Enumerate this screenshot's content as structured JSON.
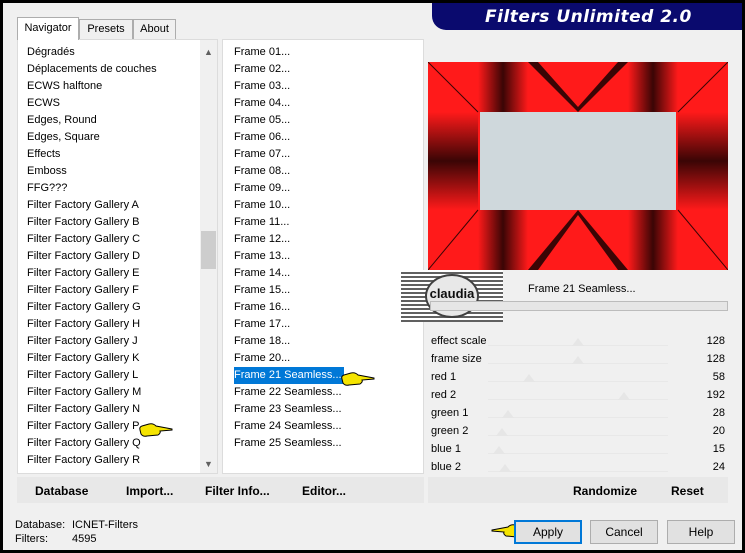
{
  "app": {
    "title": "Filters Unlimited 2.0"
  },
  "tabs": [
    "Navigator",
    "Presets",
    "About"
  ],
  "categories": [
    "Dégradés",
    "Déplacements de couches",
    "ECWS halftone",
    "ECWS",
    "Edges, Round",
    "Edges, Square",
    "Effects",
    "Emboss",
    "FFG???",
    "Filter Factory Gallery A",
    "Filter Factory Gallery B",
    "Filter Factory Gallery C",
    "Filter Factory Gallery D",
    "Filter Factory Gallery E",
    "Filter Factory Gallery F",
    "Filter Factory Gallery G",
    "Filter Factory Gallery H",
    "Filter Factory Gallery J",
    "Filter Factory Gallery K",
    "Filter Factory Gallery L",
    "Filter Factory Gallery M",
    "Filter Factory Gallery N",
    "Filter Factory Gallery P",
    "Filter Factory Gallery Q",
    "Filter Factory Gallery R"
  ],
  "selected_category": "Filter Factory Gallery P",
  "filters": [
    "Frame 01...",
    "Frame 02...",
    "Frame 03...",
    "Frame 04...",
    "Frame 05...",
    "Frame 06...",
    "Frame 07...",
    "Frame 08...",
    "Frame 09...",
    "Frame 10...",
    "Frame 11...",
    "Frame 12...",
    "Frame 13...",
    "Frame 14...",
    "Frame 15...",
    "Frame 16...",
    "Frame 17...",
    "Frame 18...",
    "Frame 20...",
    "Frame 21 Seamless...",
    "Frame 22 Seamless...",
    "Frame 23 Seamless...",
    "Frame 24 Seamless...",
    "Frame 25 Seamless..."
  ],
  "selected_filter": "Frame 21 Seamless...",
  "filter_name_display": "Frame 21 Seamless...",
  "watermark": "claudia",
  "params": [
    {
      "label": "effect scale",
      "value": 128
    },
    {
      "label": "frame size",
      "value": 128
    },
    {
      "label": "red 1",
      "value": 58
    },
    {
      "label": "red 2",
      "value": 192
    },
    {
      "label": "green 1",
      "value": 28
    },
    {
      "label": "green 2",
      "value": 20
    },
    {
      "label": "blue 1",
      "value": 15
    },
    {
      "label": "blue 2",
      "value": 24
    }
  ],
  "left_buttons": {
    "database": "Database",
    "import": "Import...",
    "filter_info": "Filter Info...",
    "editor": "Editor..."
  },
  "right_buttons": {
    "randomize": "Randomize",
    "reset": "Reset"
  },
  "status": {
    "database_label": "Database:",
    "database_value": "ICNET-Filters",
    "filters_label": "Filters:",
    "filters_value": "4595"
  },
  "dialog_buttons": {
    "apply": "Apply",
    "cancel": "Cancel",
    "help": "Help"
  },
  "colors": {
    "banner": "#0a0a6e",
    "selection": "#0078d7",
    "preview_red": "#ff1a1a",
    "preview_center": "#cfd8dc"
  }
}
